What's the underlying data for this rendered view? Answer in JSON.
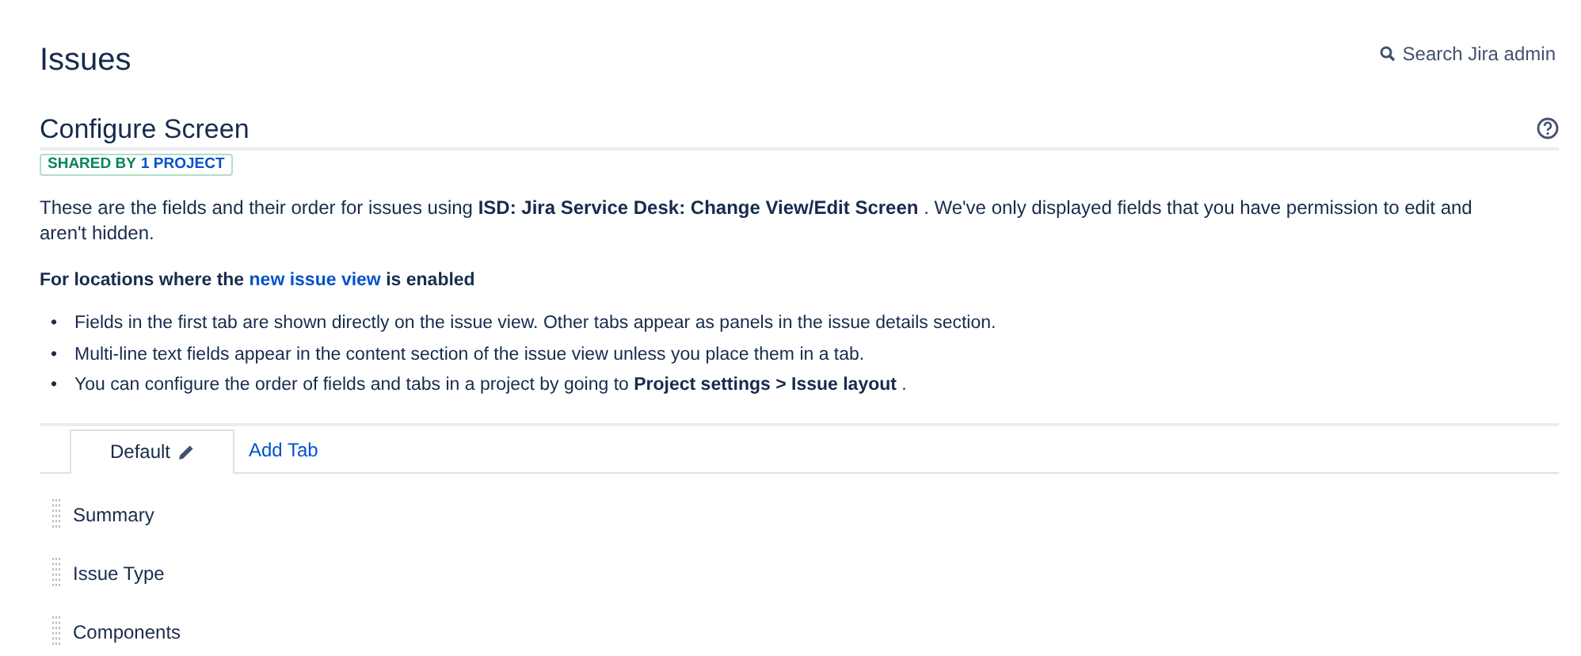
{
  "page_title": "Issues",
  "search": {
    "placeholder": "Search Jira admin"
  },
  "screen": {
    "title": "Configure Screen",
    "badge": {
      "label": "SHARED BY",
      "link": "1 PROJECT"
    }
  },
  "description": "These are the fields and their order for issues using **ISD: Jira Service Desk: Change View/Edit Screen** . We've only displayed fields that you have permission to edit and aren't hidden.",
  "notice": {
    "prefix": "For locations where the",
    "link": "new issue view",
    "suffix": "is enabled"
  },
  "bullets": [
    {
      "marker": "•",
      "text": "Fields in the first tab are shown directly on the issue view. Other tabs appear as panels in the issue details section."
    },
    {
      "marker": "•",
      "text": "Multi-line text fields appear in the content section of the issue view unless you place them in a tab."
    },
    {
      "marker": "•",
      "text": "You can configure the order of fields and tabs in a project by going to **Project settings > Issue layout** ."
    }
  ],
  "tabs": [
    {
      "label": "Default",
      "selected": true
    }
  ],
  "add_tab": "Add Tab",
  "fields": [
    "Summary",
    "Issue Type",
    "Components"
  ]
}
